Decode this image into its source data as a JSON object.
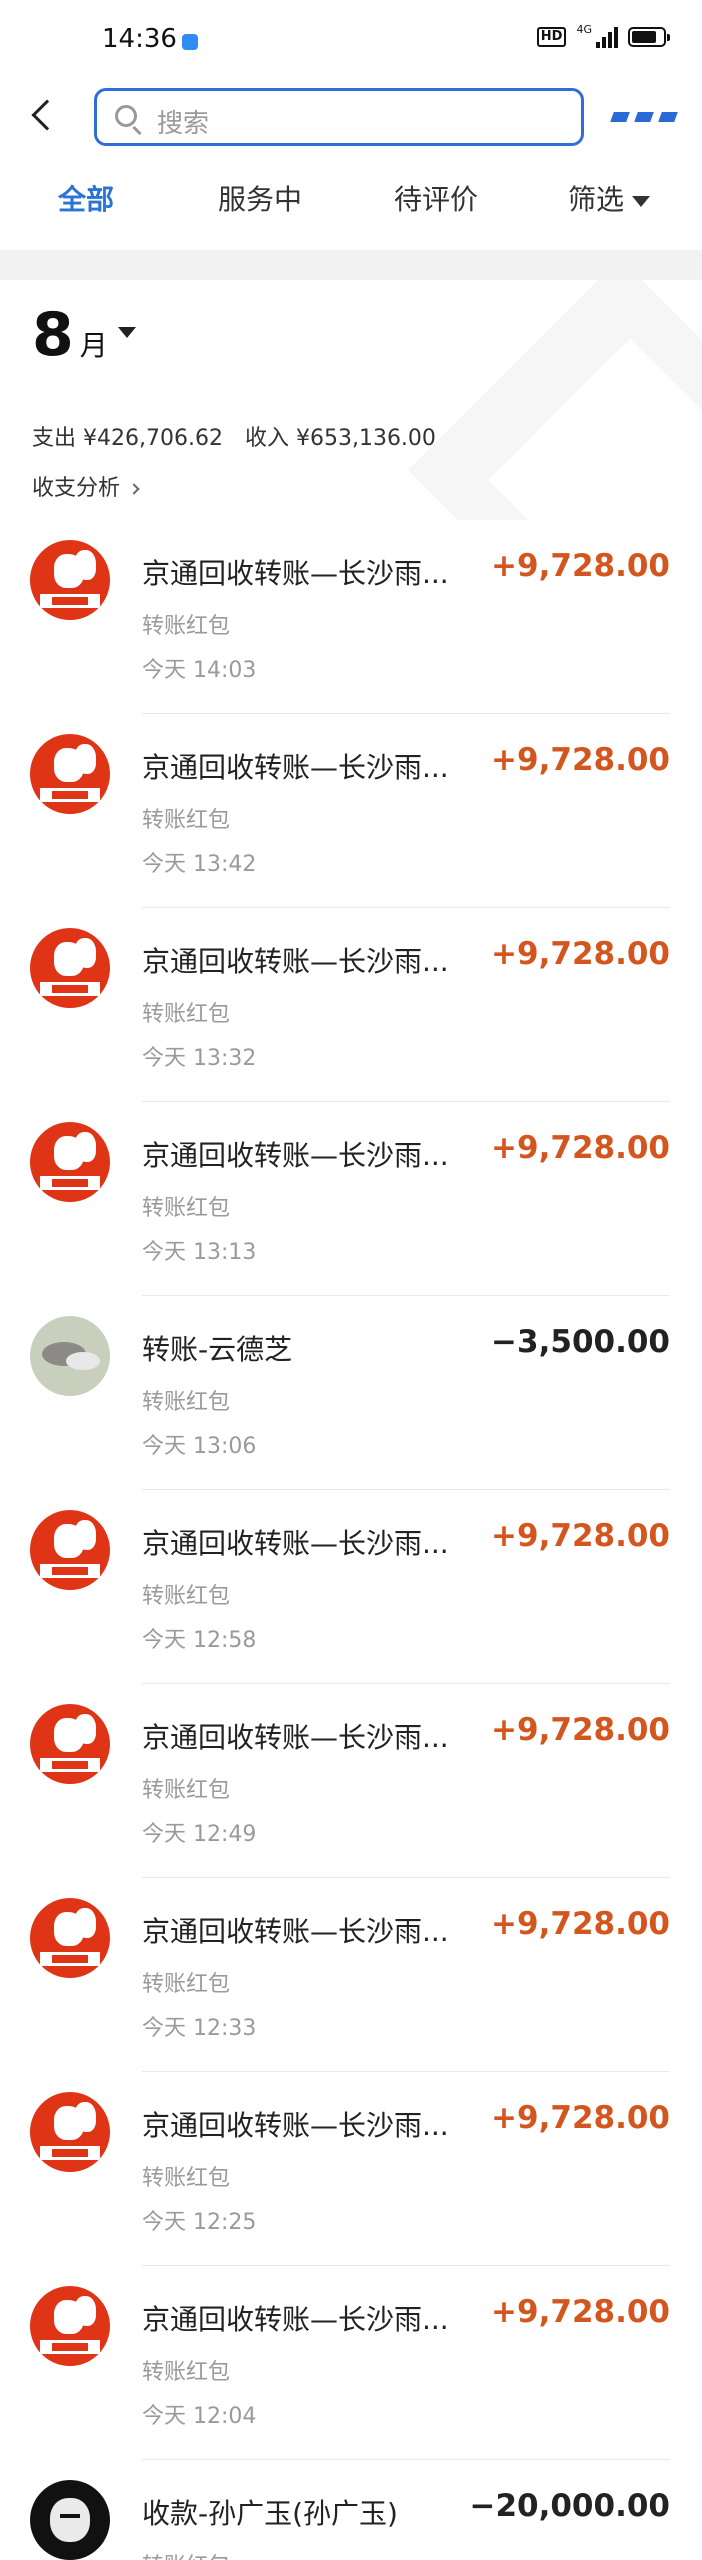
{
  "status_bar": {
    "time": "14:36",
    "hd": "HD",
    "network": "4G"
  },
  "header": {
    "search_placeholder": "搜索"
  },
  "tabs": [
    {
      "label": "全部",
      "active": true
    },
    {
      "label": "服务中",
      "active": false
    },
    {
      "label": "待评价",
      "active": false
    },
    {
      "label": "筛选",
      "active": false
    }
  ],
  "summary": {
    "month": "8",
    "month_unit": "月",
    "expense": "支出 ¥426,706.62",
    "income": "收入 ¥653,136.00",
    "analysis": "收支分析"
  },
  "transactions": [
    {
      "title": "京通回收转账—长沙雨...",
      "type": "转账红包",
      "time": "今天 14:03",
      "amount": "+9,728.00",
      "avatar": "jingtong-logo-icon"
    },
    {
      "title": "京通回收转账—长沙雨...",
      "type": "转账红包",
      "time": "今天 13:42",
      "amount": "+9,728.00",
      "avatar": "jingtong-logo-icon"
    },
    {
      "title": "京通回收转账—长沙雨...",
      "type": "转账红包",
      "time": "今天 13:32",
      "amount": "+9,728.00",
      "avatar": "jingtong-logo-icon"
    },
    {
      "title": "京通回收转账—长沙雨...",
      "type": "转账红包",
      "time": "今天 13:13",
      "amount": "+9,728.00",
      "avatar": "jingtong-logo-icon"
    },
    {
      "title": "转账-云德芝",
      "type": "转账红包",
      "time": "今天 13:06",
      "amount": "−3,500.00",
      "avatar": "photo-avatar"
    },
    {
      "title": "京通回收转账—长沙雨...",
      "type": "转账红包",
      "time": "今天 12:58",
      "amount": "+9,728.00",
      "avatar": "jingtong-logo-icon"
    },
    {
      "title": "京通回收转账—长沙雨...",
      "type": "转账红包",
      "time": "今天 12:49",
      "amount": "+9,728.00",
      "avatar": "jingtong-logo-icon"
    },
    {
      "title": "京通回收转账—长沙雨...",
      "type": "转账红包",
      "time": "今天 12:33",
      "amount": "+9,728.00",
      "avatar": "jingtong-logo-icon"
    },
    {
      "title": "京通回收转账—长沙雨...",
      "type": "转账红包",
      "time": "今天 12:25",
      "amount": "+9,728.00",
      "avatar": "jingtong-logo-icon"
    },
    {
      "title": "京通回收转账—长沙雨...",
      "type": "转账红包",
      "time": "今天 12:04",
      "amount": "+9,728.00",
      "avatar": "jingtong-logo-icon"
    },
    {
      "title": "收款-孙广玉(孙广玉)",
      "type": "转账红包",
      "time": "",
      "amount": "−20,000.00",
      "avatar": "cartoon-avatar"
    }
  ],
  "colors": {
    "accent": "#2a74d4",
    "income": "#d4561f",
    "brand_red": "#e03416"
  }
}
